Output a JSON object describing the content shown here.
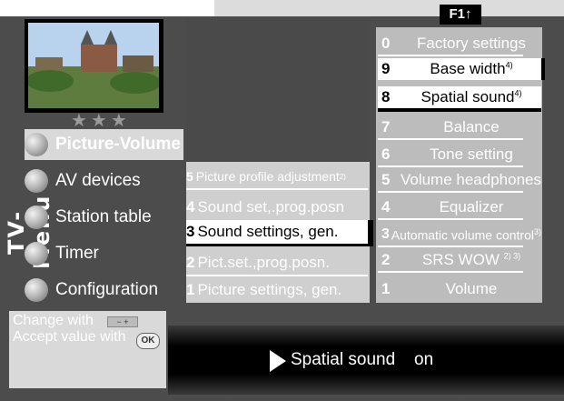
{
  "f1_label": "F1",
  "f1_arrow": "↑",
  "sidebar_title": "TV-Menu",
  "stars": "★★★",
  "menu": [
    {
      "label": "Picture-Volume"
    },
    {
      "label": "AV devices"
    },
    {
      "label": "Station table"
    },
    {
      "label": "Timer"
    },
    {
      "label": "Configuration"
    }
  ],
  "mid_rows": [
    {
      "num": "5",
      "label": "Picture profile adjustment",
      "sup": "2)"
    },
    {
      "num": "4",
      "label": "Sound set,.prog.posn",
      "sup": ""
    },
    {
      "num": "3",
      "label": "Sound settings, gen.",
      "sup": ""
    },
    {
      "num": "2",
      "label": "Pict.set.,prog.posn.",
      "sup": ""
    },
    {
      "num": "1",
      "label": "Picture settings, gen.",
      "sup": ""
    }
  ],
  "right_rows": [
    {
      "num": "0",
      "label": "Factory  settings",
      "sup": ""
    },
    {
      "num": "9",
      "label": "Base width",
      "sup": "4)"
    },
    {
      "num": "8",
      "label": "Spatial sound",
      "sup": "4)"
    },
    {
      "num": "7",
      "label": "Balance",
      "sup": ""
    },
    {
      "num": "6",
      "label": "Tone setting",
      "sup": ""
    },
    {
      "num": "5",
      "label": "Volume headphones",
      "sup": ""
    },
    {
      "num": "4",
      "label": "Equalizer",
      "sup": ""
    },
    {
      "num": "3",
      "label": "Automatic volume control",
      "sup": "3)"
    },
    {
      "num": "2",
      "label": "SRS WOW",
      "sup": "2) 3)"
    },
    {
      "num": "1",
      "label": "Volume",
      "sup": ""
    }
  ],
  "info": {
    "line1": "Change with",
    "line2": "Accept value with",
    "minus_plus": "− +",
    "ok": "OK"
  },
  "value": {
    "label": "Spatial sound",
    "val": "on"
  }
}
